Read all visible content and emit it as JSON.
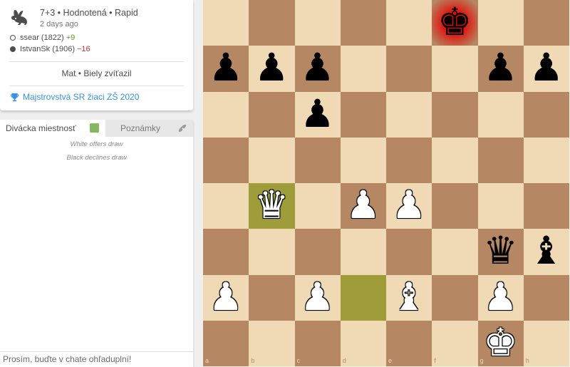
{
  "game": {
    "meta": "7+3 • Hodnotená • Rapid",
    "date": "2 days ago",
    "white_player": {
      "name": "ssear",
      "rating": "(1822)",
      "diff": "+9"
    },
    "black_player": {
      "name": "IstvanSk",
      "rating": "(1906)",
      "diff": "−16"
    },
    "result": "Mat • Biely zvíťazil",
    "tournament": "Majstrovstvá SR žiaci ZŠ 2020"
  },
  "chat": {
    "tab_spectator": "Divácka miestnosť",
    "tab_notes": "Poznámky",
    "messages": [
      "White offers draw",
      "Black declines draw"
    ],
    "input_placeholder": "Prosím, buďte v chate ohľaduplní!"
  },
  "board": {
    "orientation": "white",
    "files": [
      "a",
      "b",
      "c",
      "d",
      "e",
      "f",
      "g",
      "h"
    ],
    "ranks": [
      "8",
      "7",
      "6",
      "5",
      "4",
      "3",
      "2",
      "1"
    ],
    "last_move": [
      "d2",
      "b4"
    ],
    "in_check": "f8",
    "pieces": [
      {
        "sq": "f8",
        "p": "k",
        "color": "b"
      },
      {
        "sq": "a7",
        "p": "p",
        "color": "b"
      },
      {
        "sq": "b7",
        "p": "p",
        "color": "b"
      },
      {
        "sq": "c7",
        "p": "p",
        "color": "b"
      },
      {
        "sq": "g7",
        "p": "p",
        "color": "b"
      },
      {
        "sq": "h7",
        "p": "p",
        "color": "b"
      },
      {
        "sq": "c6",
        "p": "p",
        "color": "b"
      },
      {
        "sq": "b4",
        "p": "q",
        "color": "w"
      },
      {
        "sq": "d4",
        "p": "p",
        "color": "w"
      },
      {
        "sq": "e4",
        "p": "p",
        "color": "w"
      },
      {
        "sq": "g3",
        "p": "q",
        "color": "b"
      },
      {
        "sq": "h3",
        "p": "b",
        "color": "b"
      },
      {
        "sq": "a2",
        "p": "p",
        "color": "w"
      },
      {
        "sq": "c2",
        "p": "p",
        "color": "w"
      },
      {
        "sq": "e2",
        "p": "b",
        "color": "w"
      },
      {
        "sq": "g2",
        "p": "p",
        "color": "w"
      },
      {
        "sq": "g1",
        "p": "k",
        "color": "w"
      }
    ]
  },
  "colors": {
    "light_square": "#f0d9b5",
    "dark_square": "#b58863",
    "last_move": "#9f9d3a",
    "check": "#ff0000",
    "link": "#3692e7",
    "rating_gain": "#629924",
    "rating_loss": "#cc3333"
  },
  "icons": {
    "game_speed": "rabbit-icon",
    "tournament": "trophy-icon",
    "notes": "phone-icon"
  }
}
